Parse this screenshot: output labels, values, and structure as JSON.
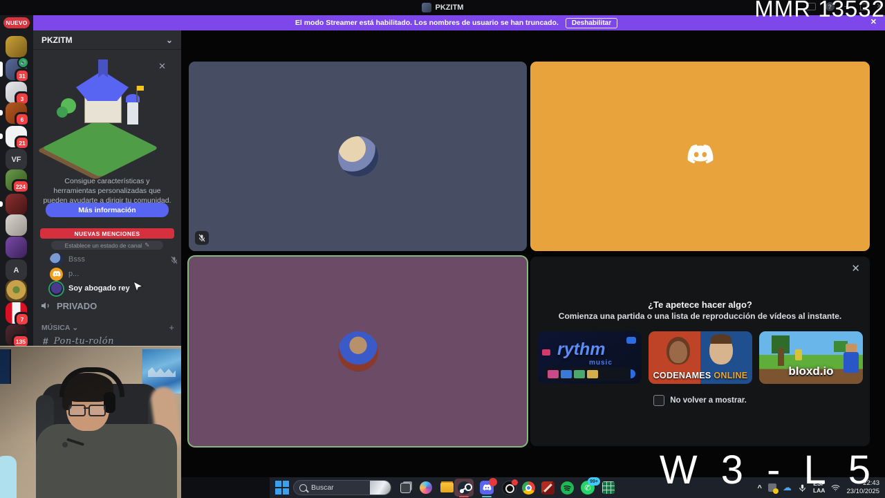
{
  "titlebar": {
    "title": "PKZITM",
    "help": "?"
  },
  "overlays": {
    "mmr": "MMR 13532",
    "score": "W 3 - L 5"
  },
  "banner": {
    "new_badge": "NUEVO",
    "message": "El modo Streamer está habilitado. Los nombres de usuario se han truncado.",
    "action": "Deshabilitar",
    "close": "✕"
  },
  "rail": {
    "items": [
      {
        "name": "gold"
      },
      {
        "name": "active-voice",
        "badge": "31"
      },
      {
        "name": "figure",
        "badge": "3"
      },
      {
        "name": "rust",
        "badge": "6"
      },
      {
        "name": "white",
        "badge": "21"
      },
      {
        "name": "vf",
        "label": "VF"
      },
      {
        "name": "green",
        "badge": "224"
      },
      {
        "name": "red"
      },
      {
        "name": "gray"
      },
      {
        "name": "purple"
      },
      {
        "name": "a",
        "label": "A"
      },
      {
        "name": "eye"
      },
      {
        "name": "peru",
        "badge": "7"
      },
      {
        "name": "dark",
        "badge": "135"
      }
    ]
  },
  "sidebar": {
    "header": "PKZITM",
    "promo": {
      "text": "Consigue características y herramientas personalizadas que pueden ayudarte a dirigir tu comunidad.",
      "button": "Más información"
    },
    "mentions": "NUEVAS MENCIONES",
    "status": "Establece un estado de canal",
    "voice_users": [
      {
        "name": "Bsss",
        "muted": true
      },
      {
        "name": "p...",
        "muted": false
      },
      {
        "name": "Soy abogado rey",
        "speaking": true
      }
    ],
    "private_channel": "PRIVADO",
    "category": "MÚSICA",
    "music_channel": "Pon-tu-rolón"
  },
  "popup": {
    "title": "¿Te apetece hacer algo?",
    "subtitle": "Comienza una partida o una lista de reproducción de vídeos al instante.",
    "cards": [
      {
        "line1": "rythm",
        "line2": "music"
      },
      {
        "line1": "CODENAMES",
        "line2": "ONLINE"
      },
      {
        "line1": "bloxd.io",
        "line2": ""
      }
    ],
    "checkbox": "No volver a mostrar."
  },
  "taskbar": {
    "search": "Buscar",
    "whatsapp_badge": "99+",
    "tray": {
      "lang1": "ESP",
      "lang2": "LAA",
      "time": "22:43",
      "date": "23/10/2025"
    }
  },
  "colors": {
    "banner": "#7d47ea",
    "accent": "#5865f2",
    "danger": "#d6303e",
    "tile_slate": "#474e63",
    "tile_orange": "#e9a33c",
    "tile_plum": "#6c4b66",
    "speaking_green": "#86b97f"
  }
}
